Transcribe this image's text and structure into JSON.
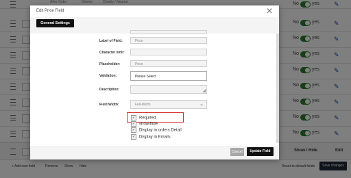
{
  "background": {
    "row_status": {
      "no": "No",
      "yes": "yes"
    },
    "top_row_text": {
      "a": "After Order",
      "b": "Dinette",
      "c": "Charity / Neutral"
    },
    "footer": {
      "show_hide": "Show / Hide",
      "edit": "Edit"
    },
    "actions": {
      "add_new_field": "+ Add new field",
      "remove": "Remove",
      "show": "Show",
      "hide": "Hide",
      "reset": "Reset to default fields",
      "save": "Save changes"
    }
  },
  "modal": {
    "title": "Edit Price Field",
    "close": "✕",
    "tab": "General Settings",
    "fields": {
      "label_of_field": {
        "label": "Label of Field:",
        "value": "Price"
      },
      "character_limit": {
        "label": "Character limit:",
        "value": ""
      },
      "placeholder": {
        "label": "Placeholder:",
        "value": "Price"
      },
      "validation": {
        "label": "Validation:",
        "value": "Please Select"
      },
      "description": {
        "label": "Description:",
        "value": ""
      },
      "field_width": {
        "label": "Field Width:",
        "value": "Full-Width"
      }
    },
    "checkboxes": [
      {
        "label": "Required",
        "checked": true
      },
      {
        "label": "show/hide",
        "checked": true
      },
      {
        "label": "Display in orders Detail",
        "checked": true
      },
      {
        "label": "Display in Emails",
        "checked": true
      }
    ],
    "buttons": {
      "cancel": "Cancel",
      "update": "Update Field"
    }
  },
  "colors": {
    "toggle_on": "#2e7d32",
    "highlight": "#d32f2f",
    "primary_dark": "#111111"
  }
}
